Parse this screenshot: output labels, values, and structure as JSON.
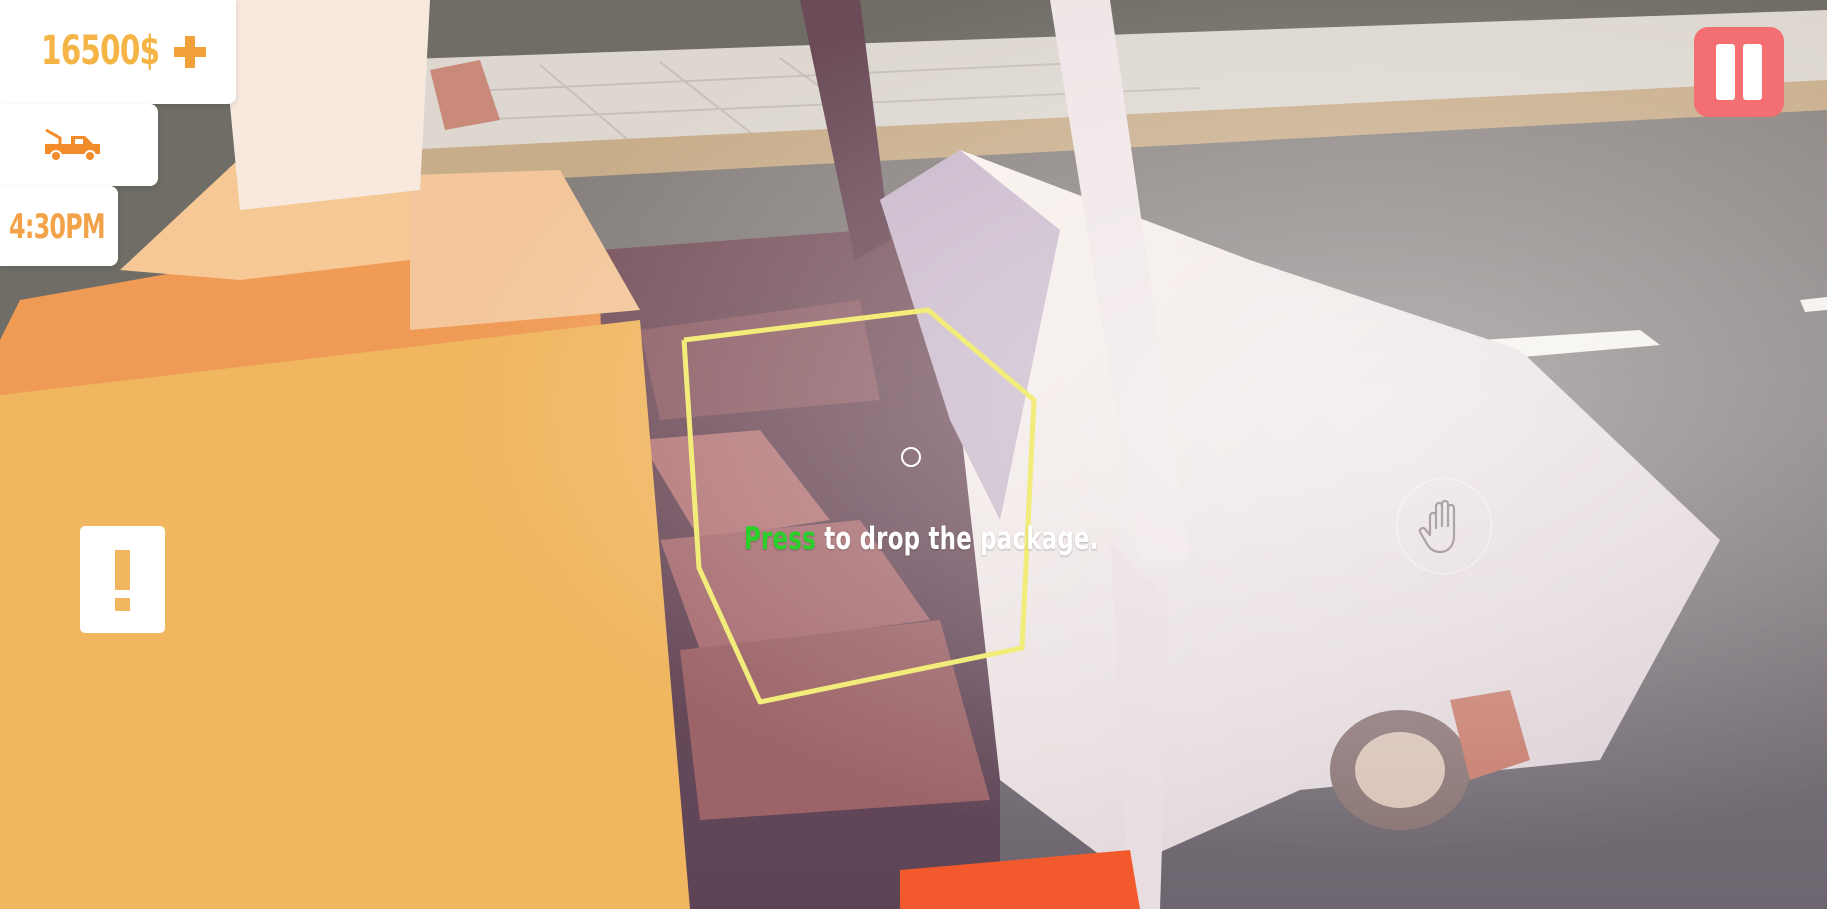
{
  "hud": {
    "money": "16500$",
    "add_money_icon": "plus-icon",
    "job_icon": "tow-truck-icon",
    "time": "4:30PM",
    "pause_icon": "pause-icon",
    "alert_icon": "exclamation-icon"
  },
  "prompt": {
    "key_label": "Press",
    "action_text": " to drop the package."
  },
  "grab": {
    "icon": "hand-icon"
  },
  "colors": {
    "accent_orange": "#f5b446",
    "pause_red": "#f36f72",
    "prompt_green": "#2ad12a",
    "highlight_yellow": "#f2ec7a"
  }
}
